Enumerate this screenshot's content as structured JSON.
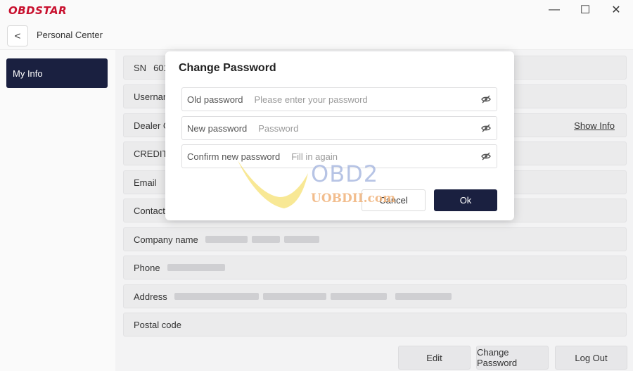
{
  "window": {
    "brand": "OBDSTAR",
    "minimize_glyph": "—",
    "maximize_glyph": "☐",
    "close_glyph": "✕"
  },
  "header": {
    "back_glyph": "<",
    "title": "Personal Center"
  },
  "sidebar": {
    "items": [
      {
        "label": "My Info",
        "active": true
      }
    ]
  },
  "info_rows": [
    {
      "label": "SN",
      "value": "601"
    },
    {
      "label": "Usernar",
      "value": ""
    },
    {
      "label": "Dealer C",
      "value": ""
    },
    {
      "label": "CREDIT",
      "value": ""
    },
    {
      "label": "Email",
      "value": ""
    },
    {
      "label": "Contact",
      "value": ""
    },
    {
      "label": "Company name",
      "value": ""
    },
    {
      "label": "Phone",
      "value": ""
    },
    {
      "label": "Address",
      "value": ""
    },
    {
      "label": "Postal code",
      "value": ""
    }
  ],
  "show_info_label": "Show Info",
  "actions": {
    "edit": "Edit",
    "change_password": "Change Password",
    "log_out": "Log Out"
  },
  "modal": {
    "title": "Change Password",
    "fields": [
      {
        "label": "Old password",
        "placeholder": "Please enter your password",
        "value": ""
      },
      {
        "label": "New password",
        "placeholder": "Password",
        "value": ""
      },
      {
        "label": "Confirm new password",
        "placeholder": "Fill in again",
        "value": ""
      }
    ],
    "cancel_label": "Cancel",
    "ok_label": "Ok"
  },
  "watermark": {
    "brand": "OBD2",
    "site": "UOBDII.com"
  },
  "colors": {
    "accent": "#1a2040",
    "brand_red": "#c8102e",
    "panel": "#ebebec"
  },
  "icons": {
    "back": "chevron-left-icon",
    "visibility": "eye-off-icon"
  }
}
